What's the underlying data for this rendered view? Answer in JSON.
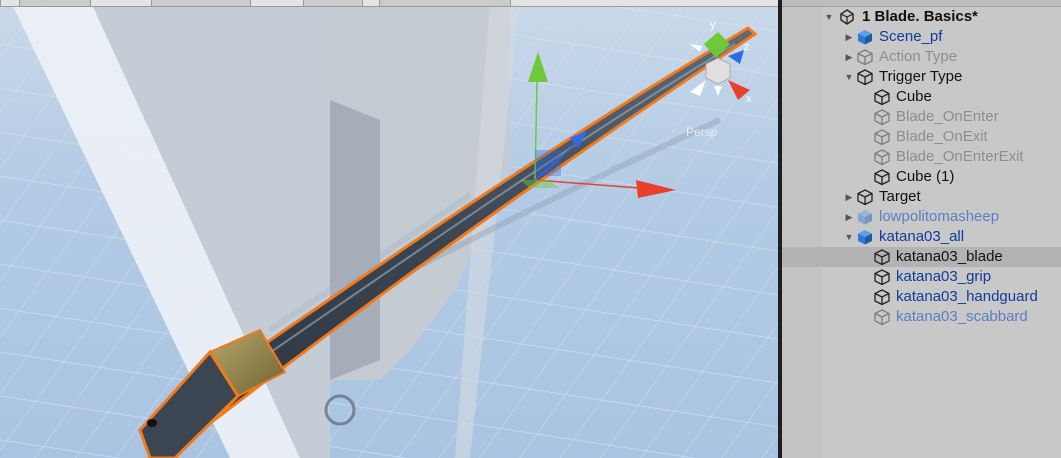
{
  "scene": {
    "gizmo_axes": {
      "y": "y",
      "z": "z",
      "x": "x"
    },
    "persp_label": "Persp",
    "colors": {
      "outline": "#f07a1c",
      "x_axis": "#e8402c",
      "y_axis": "#6ec93a",
      "z_axis": "#2e6be6"
    }
  },
  "hierarchy": {
    "root_label": "1 Blade. Basics*",
    "items": [
      {
        "label": "Scene_pf",
        "style": "blue",
        "icon": "prefab-cube-icon",
        "expander": "collapsed"
      },
      {
        "label": "Action Type",
        "style": "disabled",
        "icon": "gameobject-cube-icon",
        "expander": "collapsed"
      },
      {
        "label": "Trigger Type",
        "style": "normal",
        "icon": "gameobject-cube-icon",
        "expander": "expanded"
      },
      {
        "label": "Cube",
        "style": "normal",
        "icon": "gameobject-cube-icon",
        "expander": "none"
      },
      {
        "label": "Blade_OnEnter",
        "style": "disabled",
        "icon": "gameobject-cube-icon",
        "expander": "none"
      },
      {
        "label": "Blade_OnExit",
        "style": "disabled",
        "icon": "gameobject-cube-icon",
        "expander": "none"
      },
      {
        "label": "Blade_OnEnterExit",
        "style": "disabled",
        "icon": "gameobject-cube-icon",
        "expander": "none"
      },
      {
        "label": "Cube (1)",
        "style": "normal",
        "icon": "gameobject-cube-icon",
        "expander": "none"
      },
      {
        "label": "Target",
        "style": "normal",
        "icon": "gameobject-cube-icon",
        "expander": "collapsed"
      },
      {
        "label": "lowpolitomasheep",
        "style": "lightblue",
        "icon": "prefab-cube-icon",
        "expander": "collapsed"
      },
      {
        "label": "katana03_all",
        "style": "blue",
        "icon": "prefab-cube-icon",
        "expander": "expanded"
      },
      {
        "label": "katana03_blade",
        "style": "normal",
        "icon": "gameobject-cube-icon",
        "expander": "none",
        "selected": true
      },
      {
        "label": "katana03_grip",
        "style": "blue",
        "icon": "gameobject-cube-icon",
        "expander": "none"
      },
      {
        "label": "katana03_handguard",
        "style": "blue",
        "icon": "gameobject-cube-icon",
        "expander": "none"
      },
      {
        "label": "katana03_scabbard",
        "style": "lightblue",
        "icon": "gameobject-cube-icon",
        "expander": "none"
      }
    ]
  }
}
